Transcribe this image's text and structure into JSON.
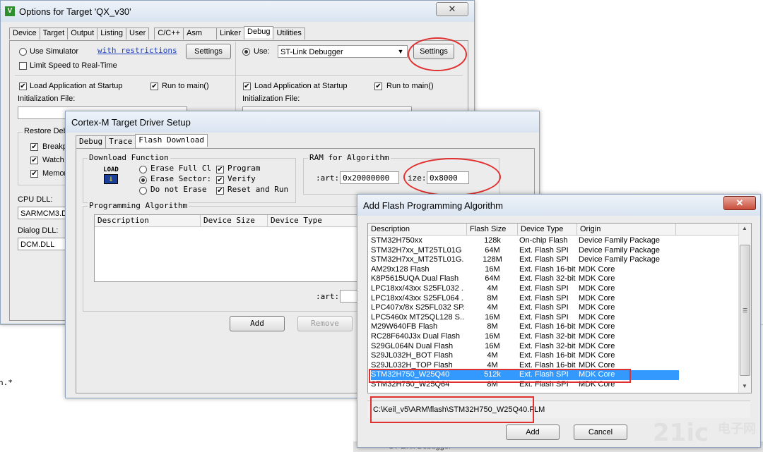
{
  "opt": {
    "title": "Options for Target 'QX_v30'",
    "tabs": [
      "Device",
      "Target",
      "Output",
      "Listing",
      "User",
      "C/C++",
      "Asm",
      "Linker",
      "Debug",
      "Utilities"
    ],
    "use_simulator": "Use Simulator",
    "with_restrictions": "with restrictions",
    "settings": "Settings",
    "use": "Use:",
    "debugger": "ST-Link Debugger",
    "settings2": "Settings",
    "limit_speed": "Limit Speed to Real-Time",
    "load_app": "Load Application at Startup",
    "run_main": "Run to main()",
    "init_file": "Initialization File:",
    "restore": "Restore Deb",
    "breakp": "Breakp",
    "watch": "Watch",
    "memory": "Memor",
    "cpu_dll": "CPU DLL:",
    "cpu_dll_val": "SARMCM3.DL",
    "dialog_dll": "Dialog DLL:",
    "dialog_dll_val": "DCM.DLL"
  },
  "bg": {
    "text": "n.*",
    "bottom_text": "ST-Link Debugger"
  },
  "cortex": {
    "title": "Cortex-M Target Driver Setup",
    "tabs": [
      "Debug",
      "Trace",
      "Flash Download"
    ],
    "download_function": "Download Function",
    "erase_full": "Erase Full Cl",
    "erase_sectors": "Erase Sector:",
    "do_not_erase": "Do not Erase",
    "program": "Program",
    "verify": "Verify",
    "reset_run": "Reset and Run",
    "load_icon": "LOAD",
    "ram_for_algorithm": "RAM for Algorithm",
    "start": ":art:",
    "start_val": "0x20000000",
    "size": "ize:",
    "size_val": "0x8000",
    "programming_algorithm": "Programming Algorithm",
    "cols": [
      "Description",
      "Device Size",
      "Device Type"
    ],
    "start2": ":art:",
    "add": "Add",
    "remove": "Remove"
  },
  "addflash": {
    "title": "Add Flash Programming Algorithm",
    "cols": [
      "Description",
      "Flash Size",
      "Device Type",
      "Origin"
    ],
    "rows": [
      [
        "STM32H750xx",
        "128k",
        "On-chip Flash",
        "Device Family Package"
      ],
      [
        "STM32H7xx_MT25TL01G",
        "64M",
        "Ext. Flash SPI",
        "Device Family Package"
      ],
      [
        "STM32H7xx_MT25TL01G...",
        "128M",
        "Ext. Flash SPI",
        "Device Family Package"
      ],
      [
        "AM29x128 Flash",
        "16M",
        "Ext. Flash 16-bit",
        "MDK Core"
      ],
      [
        "K8P5615UQA Dual Flash",
        "64M",
        "Ext. Flash 32-bit",
        "MDK Core"
      ],
      [
        "LPC18xx/43xx S25FL032 ...",
        "4M",
        "Ext. Flash SPI",
        "MDK Core"
      ],
      [
        "LPC18xx/43xx S25FL064 ...",
        "8M",
        "Ext. Flash SPI",
        "MDK Core"
      ],
      [
        "LPC407x/8x S25FL032 SP...",
        "4M",
        "Ext. Flash SPI",
        "MDK Core"
      ],
      [
        "LPC5460x MT25QL128 S...",
        "16M",
        "Ext. Flash SPI",
        "MDK Core"
      ],
      [
        "M29W640FB Flash",
        "8M",
        "Ext. Flash 16-bit",
        "MDK Core"
      ],
      [
        "RC28F640J3x Dual Flash",
        "16M",
        "Ext. Flash 32-bit",
        "MDK Core"
      ],
      [
        "S29GL064N Dual Flash",
        "16M",
        "Ext. Flash 32-bit",
        "MDK Core"
      ],
      [
        "S29JL032H_BOT Flash",
        "4M",
        "Ext. Flash 16-bit",
        "MDK Core"
      ],
      [
        "S29JL032H_TOP Flash",
        "4M",
        "Ext. Flash 16-bit",
        "MDK Core"
      ],
      [
        "STM32H750_W25Q40",
        "512k",
        "Ext. Flash SPI",
        "MDK Core"
      ],
      [
        "STM32H750_W25Q64",
        "8M",
        "Ext. Flash SPI",
        "MDK Core"
      ]
    ],
    "selected_index": 14,
    "path": "C:\\Keil_v5\\ARM\\flash\\STM32H750_W25Q40.FLM",
    "add": "Add",
    "cancel": "Cancel"
  },
  "watermark": {
    "a": "21ic",
    "b": "电子网"
  }
}
